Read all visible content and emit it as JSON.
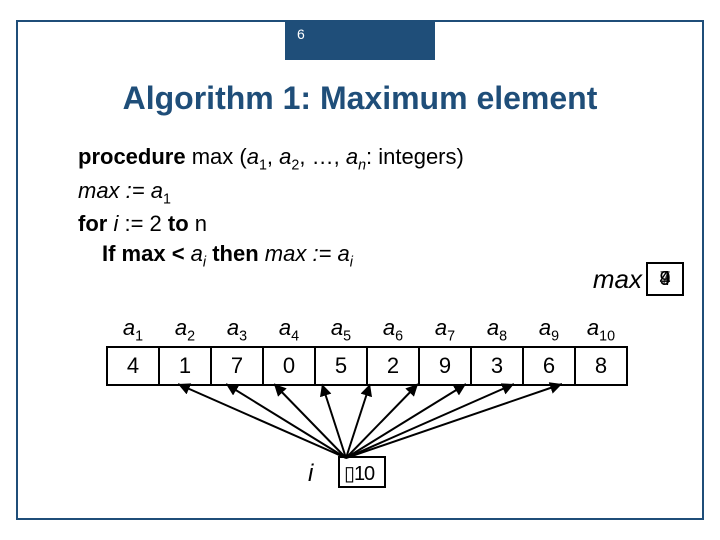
{
  "page_number": "6",
  "title": "Algorithm 1: Maximum element",
  "code": {
    "l1_pre": "procedure",
    "l1_mid": " max (",
    "l1_a": "a",
    "l1_s1": "1",
    "l1_c1": ", ",
    "l1_s2": "2",
    "l1_c2": ", …, ",
    "l1_sn": "n",
    "l1_post": ": integers)",
    "l2": "max := a",
    "l2_s": "1",
    "l3_a": "for ",
    "l3_b": "i",
    "l3_c": " := 2 ",
    "l3_d": "to",
    "l3_e": " n",
    "l4_a": "If max < ",
    "l4_b": "a",
    "l4_bs": "i",
    "l4_c": " then ",
    "l4_d": "max := a",
    "l4_ds": "i"
  },
  "max_label": "max",
  "max_values": {
    "a": "9",
    "b": "4",
    "c": "7"
  },
  "array": {
    "headers_sym": "a",
    "headers_sub": [
      "1",
      "2",
      "3",
      "4",
      "5",
      "6",
      "7",
      "8",
      "9",
      "10"
    ],
    "values": [
      "4",
      "1",
      "7",
      "0",
      "5",
      "2",
      "9",
      "3",
      "6",
      "8"
    ]
  },
  "i_label": "i",
  "i_values": {
    "a": "1",
    "b": "0",
    "boxchar": "▯"
  }
}
